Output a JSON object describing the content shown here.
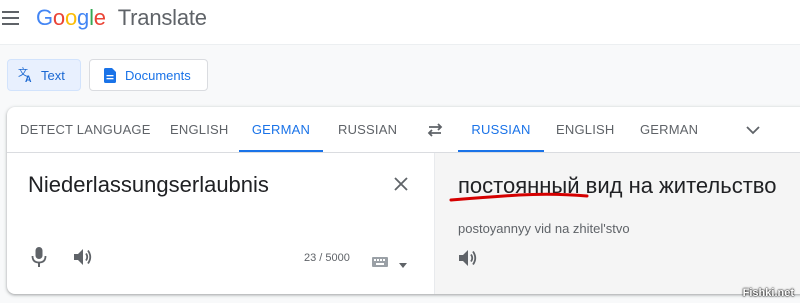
{
  "header": {
    "logo_word": "Google",
    "product": "Translate",
    "logo_colors": [
      "#4285F4",
      "#EA4335",
      "#FBBC05",
      "#4285F4",
      "#34A853",
      "#EA4335"
    ]
  },
  "modes": {
    "text_label": "Text",
    "documents_label": "Documents"
  },
  "source_tabs": [
    "DETECT LANGUAGE",
    "ENGLISH",
    "GERMAN",
    "RUSSIAN"
  ],
  "source_active": "GERMAN",
  "target_tabs": [
    "RUSSIAN",
    "ENGLISH",
    "GERMAN"
  ],
  "target_active": "RUSSIAN",
  "source": {
    "text": "Niederlassungserlaubnis",
    "char_count": "23 / 5000"
  },
  "target": {
    "text": "постоянный вид на жительство",
    "transliteration": "postoyannyy vid na zhitel'stvo"
  },
  "icons": {
    "menu": "hamburger-icon",
    "text_mode": "translate-icon",
    "documents_mode": "document-icon",
    "swap": "swap-icon",
    "more": "chevron-down-icon",
    "clear": "close-icon",
    "mic": "microphone-icon",
    "speaker": "speaker-icon",
    "keyboard": "keyboard-icon"
  },
  "colors": {
    "accent": "#1a73e8",
    "annotation_underline": "#d50000"
  },
  "watermark": "Fishki.net"
}
